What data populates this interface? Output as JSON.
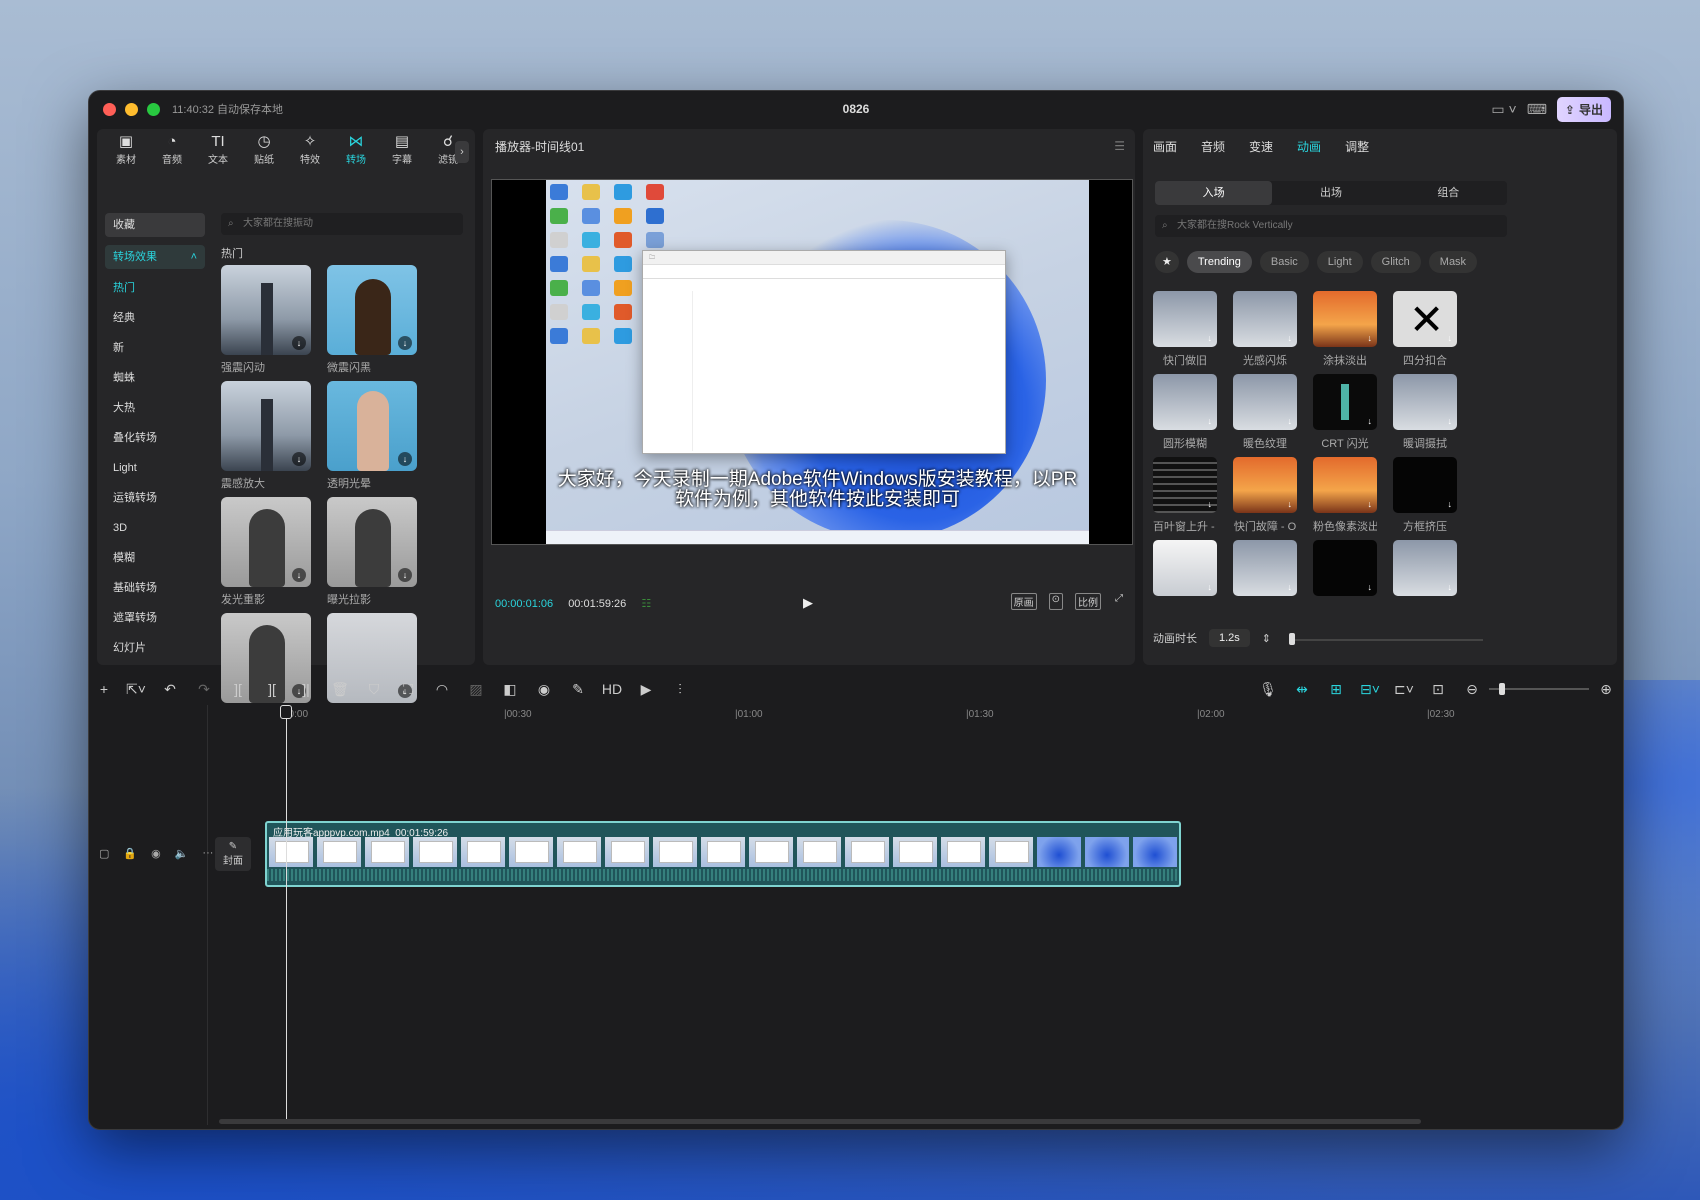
{
  "window": {
    "autosave": "11:40:32 自动保存本地",
    "title": "0826",
    "export_label": "导出"
  },
  "toolbar": [
    {
      "icon": "▣",
      "label": "素材"
    },
    {
      "icon": "◔",
      "label": "音频"
    },
    {
      "icon": "TI",
      "label": "文本"
    },
    {
      "icon": "◷",
      "label": "贴纸"
    },
    {
      "icon": "✧",
      "label": "特效"
    },
    {
      "icon": "⋈",
      "label": "转场",
      "active": true
    },
    {
      "icon": "▤",
      "label": "字幕"
    },
    {
      "icon": "☌",
      "label": "滤镜"
    }
  ],
  "left": {
    "fav": "收藏",
    "section": "转场效果",
    "categories": [
      "热门",
      "经典",
      "新",
      "蜘蛛",
      "大热",
      "叠化转场",
      "Light",
      "运镜转场",
      "3D",
      "模糊",
      "基础转场",
      "遮罩转场",
      "幻灯片"
    ],
    "search_placeholder": "大家都在搜振动",
    "hot_label": "热门",
    "items": [
      {
        "label": "强震闪动",
        "kind": "city"
      },
      {
        "label": "微震闪黑",
        "kind": "man"
      },
      {
        "label": "震感放大",
        "kind": "city"
      },
      {
        "label": "透明光晕",
        "kind": "woman"
      },
      {
        "label": "发光重影",
        "kind": "girl"
      },
      {
        "label": "曝光拉影",
        "kind": "girl"
      },
      {
        "label": "",
        "kind": "girl"
      },
      {
        "label": "",
        "kind": "tower"
      }
    ]
  },
  "player": {
    "title": "播放器-时间线01",
    "subtitle_line1": "大家好，今天录制一期Adobe软件Windows版安装教程，以PR",
    "subtitle_line2": "软件为例，其他软件按此安装即可",
    "current_time": "00:00:01:06",
    "total_time": "00:01:59:26",
    "controls": [
      "原画",
      "⊙",
      "比例",
      "⤢"
    ]
  },
  "right": {
    "tabs": [
      "画面",
      "音频",
      "变速",
      "动画",
      "调整"
    ],
    "active_tab": "动画",
    "segments": [
      "入场",
      "出场",
      "组合"
    ],
    "search_placeholder": "大家都在搜Rock Vertically",
    "chips": [
      "Trending",
      "Basic",
      "Light",
      "Glitch",
      "Mask"
    ],
    "effects": [
      {
        "label": "快门做旧",
        "kind": "snow"
      },
      {
        "label": "光感闪烁",
        "kind": "snow"
      },
      {
        "label": "涂抹淡出",
        "kind": "sunset"
      },
      {
        "label": "四分扣合",
        "kind": "x"
      },
      {
        "label": "圆形模糊",
        "kind": "snow"
      },
      {
        "label": "暖色纹理",
        "kind": "snow"
      },
      {
        "label": "CRT 闪光",
        "kind": "crt"
      },
      {
        "label": "暖调摄拭",
        "kind": "snow"
      },
      {
        "label": "百叶窗上升 - I",
        "kind": "blinds"
      },
      {
        "label": "快门故障 - O",
        "kind": "sunset"
      },
      {
        "label": "粉色像素淡出",
        "kind": "sunset"
      },
      {
        "label": "方框挤压",
        "kind": "black"
      },
      {
        "label": "",
        "kind": "white"
      },
      {
        "label": "",
        "kind": "snow"
      },
      {
        "label": "",
        "kind": "black"
      },
      {
        "label": "",
        "kind": "snow"
      }
    ],
    "duration_label": "动画时长",
    "duration_value": "1.2s"
  },
  "timeline": {
    "ticks": [
      "00:00",
      "|00:30",
      "|01:00",
      "|01:30",
      "|02:00",
      "|02:30"
    ],
    "clip_name": "应用玩客apppvp.com.mp4",
    "clip_duration": "00:01:59:26",
    "cover_label": "封面"
  }
}
